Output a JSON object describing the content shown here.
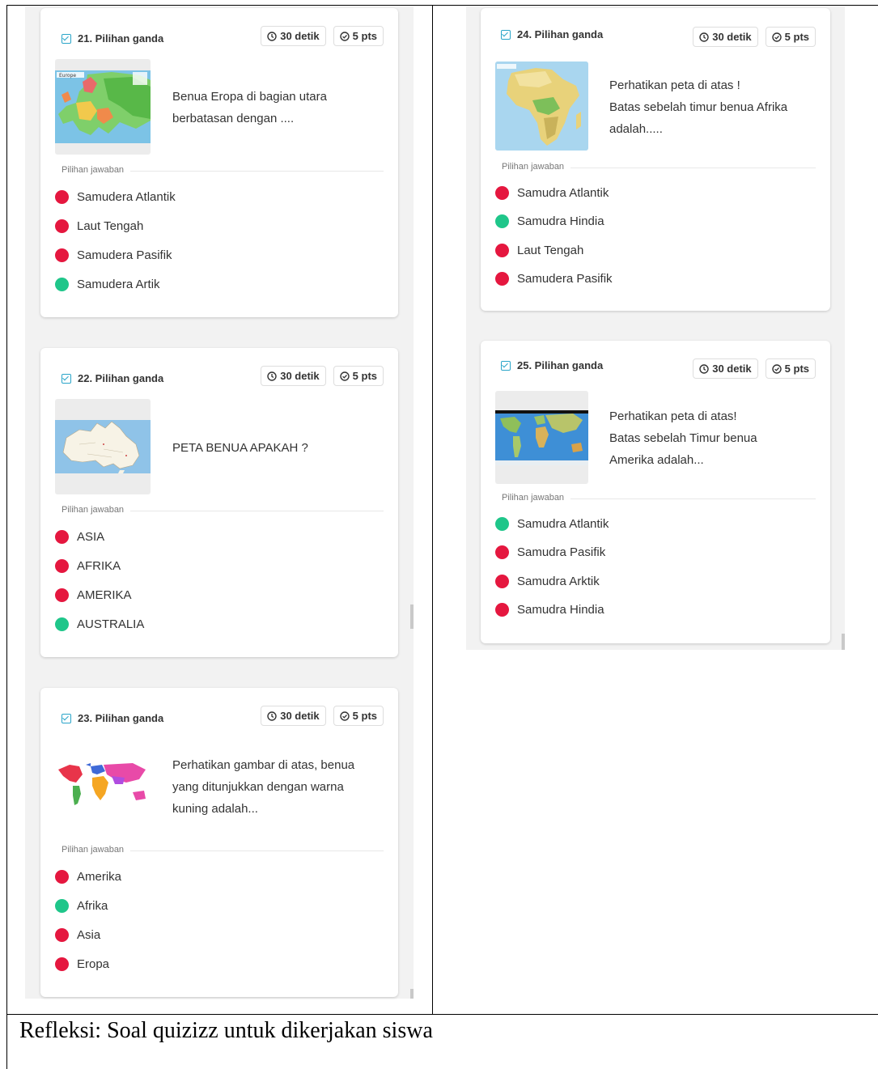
{
  "badges": {
    "time": "30 detik",
    "points": "5 pts"
  },
  "answers_label": "Pilihan jawaban",
  "questions": [
    {
      "title": "21. Pilihan ganda",
      "thumbnail": "europe-map",
      "map_label": "Europe",
      "text": "Benua Eropa di bagian utara\nberbatasan dengan ....",
      "options": [
        {
          "label": "Samudera Atlantik",
          "status": "wrong"
        },
        {
          "label": "Laut Tengah",
          "status": "wrong"
        },
        {
          "label": "Samudera Pasifik",
          "status": "wrong"
        },
        {
          "label": "Samudera Artik",
          "status": "correct"
        }
      ]
    },
    {
      "title": "22. Pilihan ganda",
      "thumbnail": "australia-map",
      "text": "PETA BENUA APAKAH ?",
      "options": [
        {
          "label": "ASIA",
          "status": "wrong"
        },
        {
          "label": "AFRIKA",
          "status": "wrong"
        },
        {
          "label": "AMERIKA",
          "status": "wrong"
        },
        {
          "label": "AUSTRALIA",
          "status": "correct"
        }
      ]
    },
    {
      "title": "23. Pilihan ganda",
      "thumbnail": "colored-world-map",
      "text": "Perhatikan gambar di atas, benua\nyang ditunjukkan dengan warna\nkuning adalah...",
      "options": [
        {
          "label": "Amerika",
          "status": "wrong"
        },
        {
          "label": "Afrika",
          "status": "correct"
        },
        {
          "label": "Asia",
          "status": "wrong"
        },
        {
          "label": "Eropa",
          "status": "wrong"
        }
      ]
    },
    {
      "title": "24. Pilihan ganda",
      "thumbnail": "africa-map",
      "text": "Perhatikan peta di atas !\nBatas sebelah timur benua Afrika\nadalah.....",
      "options": [
        {
          "label": "Samudra Atlantik",
          "status": "wrong"
        },
        {
          "label": "Samudra Hindia",
          "status": "correct"
        },
        {
          "label": "Laut Tengah",
          "status": "wrong"
        },
        {
          "label": "Samudera Pasifik",
          "status": "wrong"
        }
      ]
    },
    {
      "title": "25. Pilihan ganda",
      "thumbnail": "physical-world-map",
      "text": "Perhatikan peta di atas!\nBatas sebelah Timur benua\nAmerika adalah...",
      "options": [
        {
          "label": "Samudra Atlantik",
          "status": "correct"
        },
        {
          "label": "Samudra Pasifik",
          "status": "wrong"
        },
        {
          "label": "Samudra Arktik",
          "status": "wrong"
        },
        {
          "label": "Samudra Hindia",
          "status": "wrong"
        }
      ]
    }
  ],
  "reflection": "Refleksi: Soal quizizz untuk dikerjakan siswa",
  "colors": {
    "correct": "#1fc68a",
    "wrong": "#e5173f",
    "accent": "#2aa5c9"
  }
}
